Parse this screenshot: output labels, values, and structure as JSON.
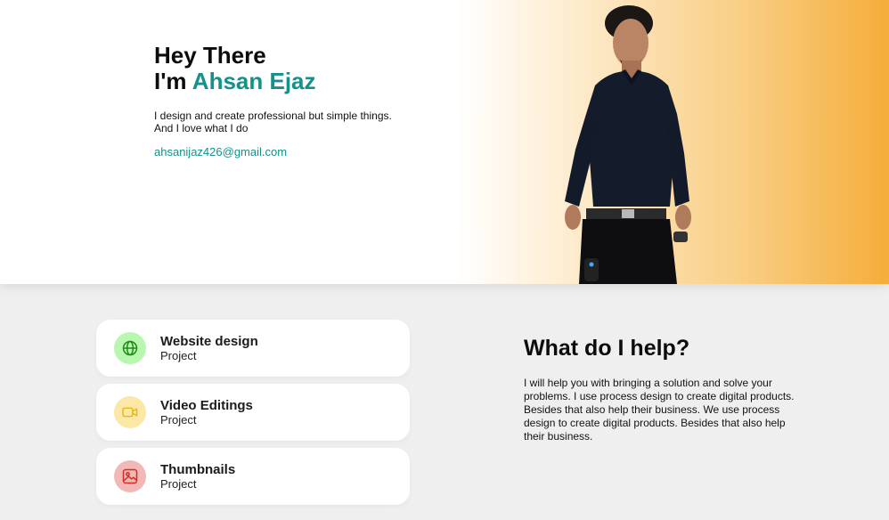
{
  "hero": {
    "greeting": "Hey There",
    "name_prefix": "I'm ",
    "name": "Ahsan Ejaz",
    "bio": "I design and create professional but simple things. And I love what I do",
    "email": "ahsanijaz426@gmail.com"
  },
  "services": [
    {
      "title": "Website design",
      "subtitle": "Project",
      "icon": "globe-icon",
      "icon_bg": "#b7f7b0",
      "icon_color": "#1f8a16"
    },
    {
      "title": "Video Editings",
      "subtitle": "Project",
      "icon": "video-camera-icon",
      "icon_bg": "#fbe8a6",
      "icon_color": "#e9b81b"
    },
    {
      "title": "Thumbnails",
      "subtitle": "Project",
      "icon": "image-icon",
      "icon_bg": "#f1b8b6",
      "icon_color": "#d72b25"
    }
  ],
  "help": {
    "title": "What do I help?",
    "text": "I will help you with bringing a solution and solve your problems. I use process design to create digital products. Besides that also help their business. We use process design to create digital products. Besides that also help their business."
  },
  "colors": {
    "accent": "#13918a",
    "gradient_end": "#f5ad3b"
  }
}
